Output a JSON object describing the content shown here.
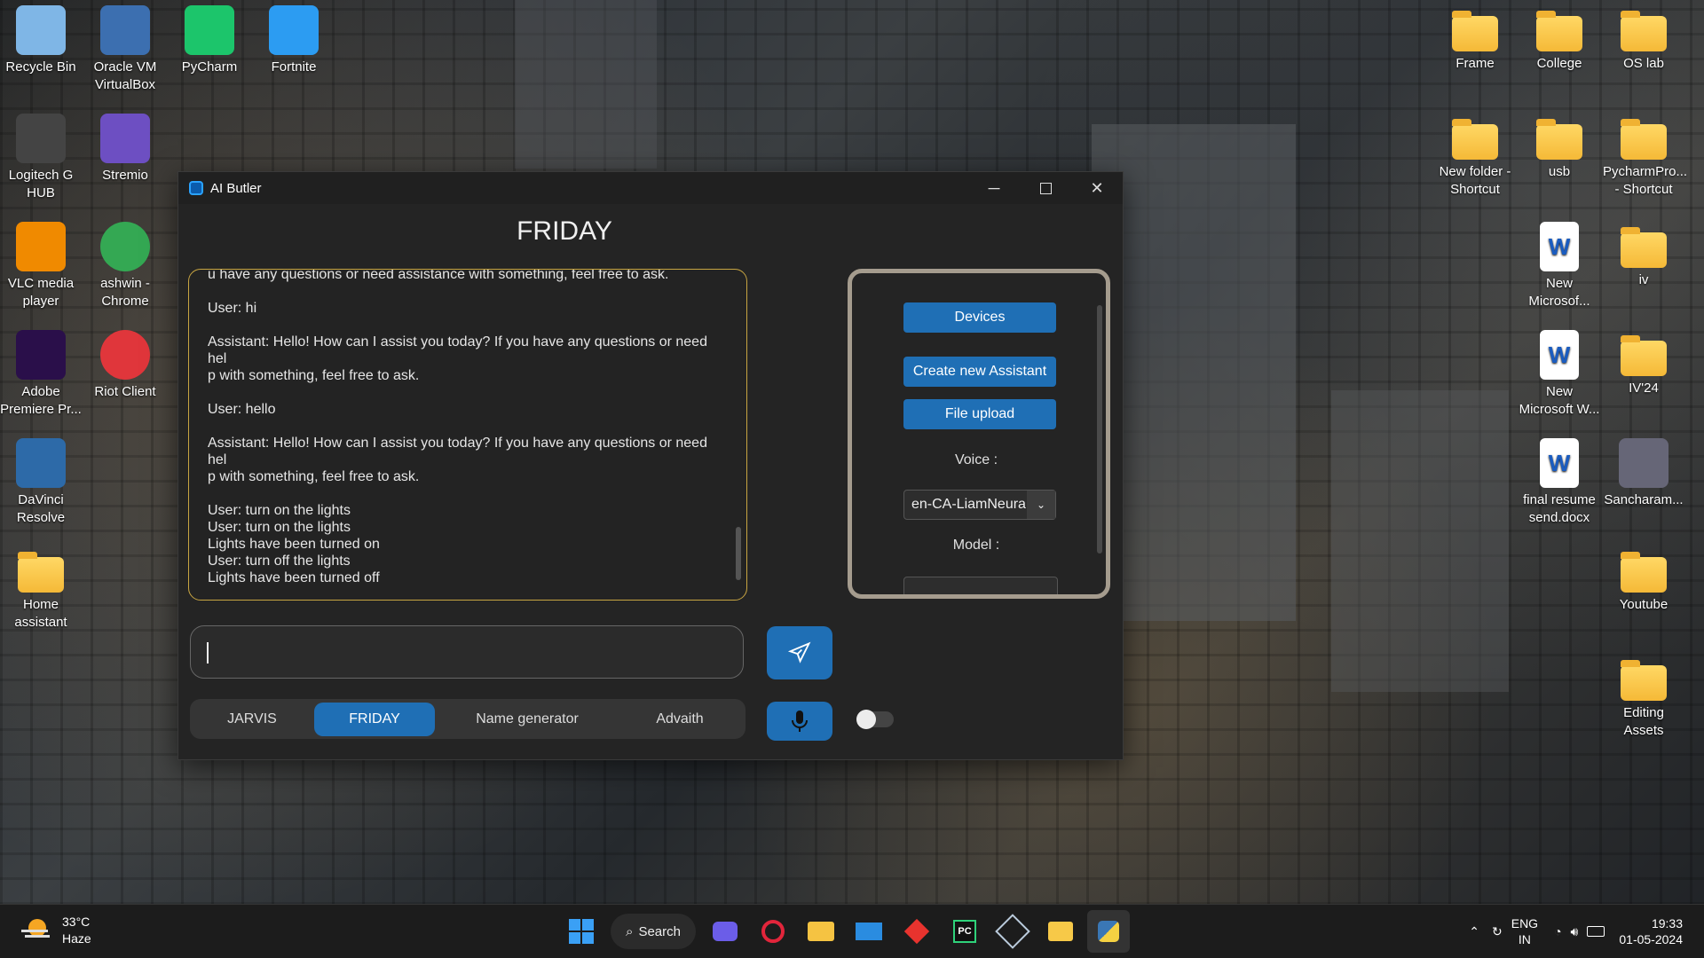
{
  "desktop": {
    "left_icons": [
      {
        "label": "Recycle Bin",
        "icon": "recycle-bin-icon"
      },
      {
        "label": "Oracle VM VirtualBox",
        "icon": "virtualbox-icon"
      },
      {
        "label": "PyCharm",
        "icon": "pycharm-icon"
      },
      {
        "label": "Fortnite",
        "icon": "fortnite-icon"
      },
      {
        "label": "Logitech G HUB",
        "icon": "logitech-icon"
      },
      {
        "label": "Stremio",
        "icon": "stremio-icon"
      },
      {
        "label": "VLC media player",
        "icon": "vlc-icon"
      },
      {
        "label": "ashwin - Chrome",
        "icon": "chrome-icon"
      },
      {
        "label": "Adobe Premiere Pr...",
        "icon": "premiere-icon"
      },
      {
        "label": "Riot Client",
        "icon": "riot-icon"
      },
      {
        "label": "DaVinci Resolve",
        "icon": "davinci-icon"
      },
      {
        "label": "Home assistant",
        "icon": "folder-icon"
      }
    ],
    "right_icons": [
      {
        "label": "Frame",
        "icon": "folder-icon"
      },
      {
        "label": "College",
        "icon": "folder-icon"
      },
      {
        "label": "OS lab",
        "icon": "folder-icon"
      },
      {
        "label": "New folder - Shortcut",
        "icon": "folder-icon"
      },
      {
        "label": "usb",
        "icon": "folder-icon"
      },
      {
        "label": "PycharmPro... - Shortcut",
        "icon": "folder-icon"
      },
      {
        "label": "New Microsof...",
        "icon": "word-icon"
      },
      {
        "label": "iv",
        "icon": "folder-icon"
      },
      {
        "label": "New Microsoft W...",
        "icon": "word-icon"
      },
      {
        "label": "IV'24",
        "icon": "folder-icon"
      },
      {
        "label": "final resume send.docx",
        "icon": "word-icon"
      },
      {
        "label": "Sancharam...",
        "icon": "image-icon"
      },
      {
        "label": "Youtube",
        "icon": "folder-icon"
      },
      {
        "label": "Editing Assets",
        "icon": "folder-icon"
      }
    ]
  },
  "window": {
    "title": "AI Butler",
    "heading": "FRIDAY",
    "chat_text": "u have any questions or need assistance with something, feel free to ask.\n\nUser: hi\n\nAssistant: Hello! How can I assist you today? If you have any questions or need hel\np with something, feel free to ask.\n\nUser: hello\n\nAssistant: Hello! How can I assist you today? If you have any questions or need hel\np with something, feel free to ask.\n\nUser: turn on the lights\nUser: turn on the lights\nLights have been turned on\nUser: turn off the lights\nLights have been turned off",
    "side": {
      "devices": "Devices",
      "create": "Create new Assistant",
      "upload": "File upload",
      "voice_label": "Voice :",
      "voice_value": "en-CA-LiamNeural",
      "model_label": "Model :"
    },
    "input_value": "",
    "tabs": [
      "JARVIS",
      "FRIDAY",
      "Name generator",
      "Advaith"
    ],
    "active_tab": "FRIDAY",
    "accent": "#1f6fb5",
    "chat_border": "#c8a542"
  },
  "taskbar": {
    "weather_temp": "33°C",
    "weather_desc": "Haze",
    "search": "Search",
    "lang1": "ENG",
    "lang2": "IN",
    "time": "19:33",
    "date": "01-05-2024"
  }
}
